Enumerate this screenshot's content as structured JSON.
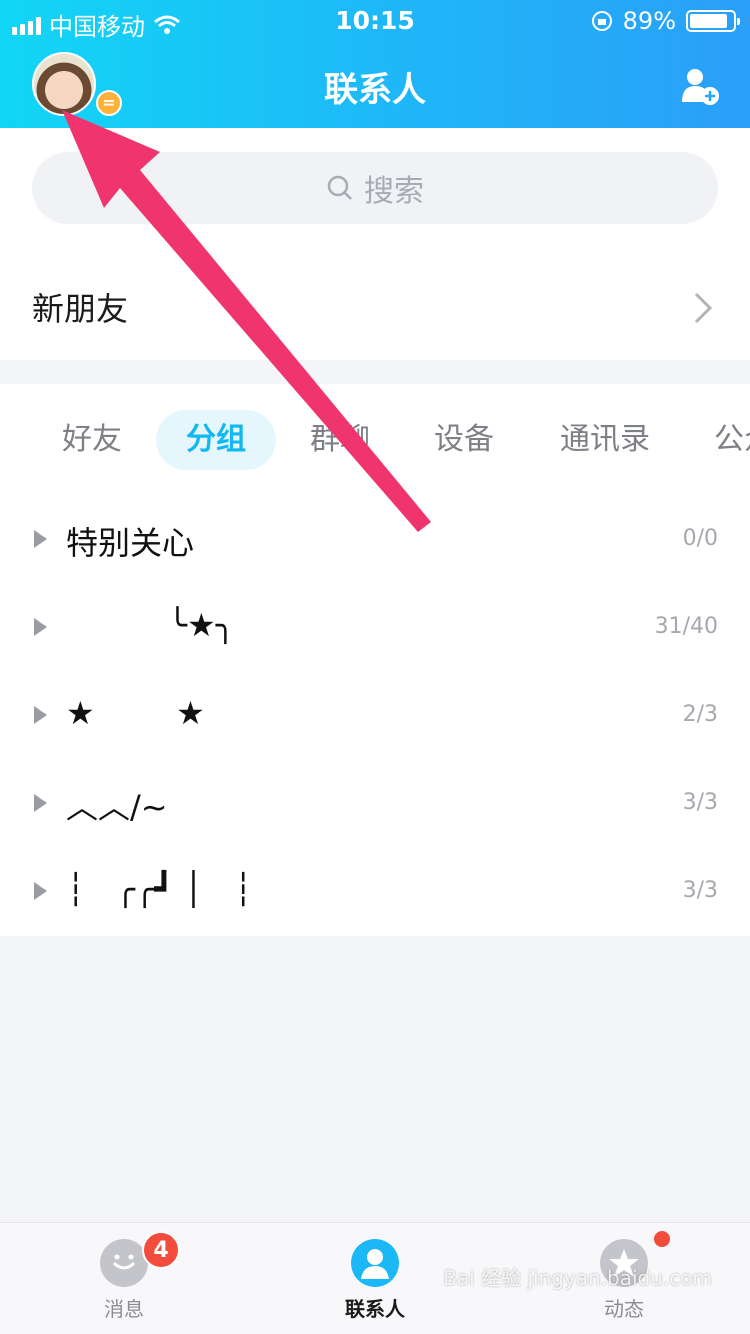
{
  "status_bar": {
    "carrier": "中国移动",
    "time": "10:15",
    "battery": "89%",
    "battery_level": 0.89
  },
  "header": {
    "title": "联系人",
    "add_icon": "add-contact-icon",
    "avatar_badge": "="
  },
  "search": {
    "placeholder": "搜索"
  },
  "new_friend": {
    "label": "新朋友"
  },
  "tabs": [
    {
      "label": "好友",
      "active": false
    },
    {
      "label": "分组",
      "active": true
    },
    {
      "label": "群聊",
      "active": false
    },
    {
      "label": "设备",
      "active": false
    },
    {
      "label": "通讯录",
      "active": false
    },
    {
      "label": "公众号",
      "active": false
    }
  ],
  "groups": [
    {
      "name": "特别关心",
      "count": "0/0"
    },
    {
      "name": "          ╰★╮",
      "count": "31/40"
    },
    {
      "name": "★        ★",
      "count": "2/3"
    },
    {
      "name": "︿︿/~",
      "count": "3/3"
    },
    {
      "name": "┆   ╭╭┛ │   ┆",
      "count": "3/3"
    }
  ],
  "tabbar": [
    {
      "label": "消息",
      "badge": "4",
      "active": false
    },
    {
      "label": "联系人",
      "active": true
    },
    {
      "label": "动态",
      "dot": true,
      "active": false
    }
  ],
  "watermark": "Bai 经验 jingyan.baidu.com",
  "colors": {
    "accent": "#1cb8f5",
    "arrow": "#f0356e",
    "badge": "#f24c3d"
  }
}
